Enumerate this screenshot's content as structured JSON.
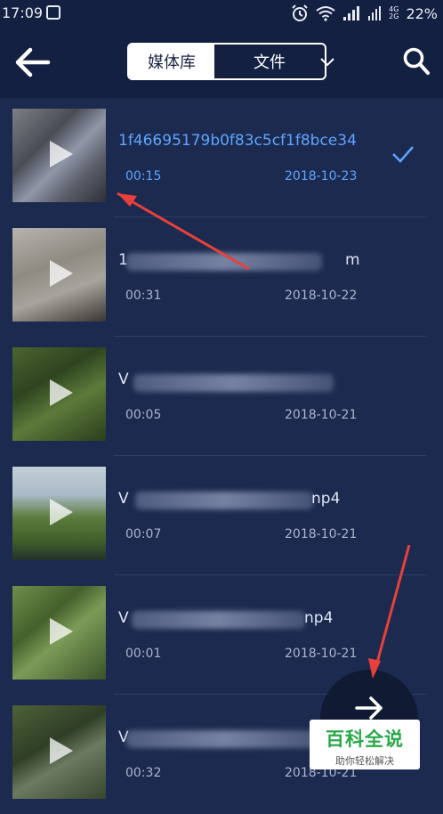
{
  "status_bar": {
    "time": "17:09",
    "battery": "22%",
    "network_top": "4G",
    "network_bottom": "2G"
  },
  "header": {
    "tabs": [
      {
        "label": "媒体库",
        "active": true
      },
      {
        "label": "文件",
        "active": false
      }
    ]
  },
  "videos": [
    {
      "name": "1f46695179b0f83c5cf1f8bce34",
      "duration": "00:15",
      "date": "2018-10-23",
      "selected": true
    },
    {
      "name": "1",
      "name_end": "m",
      "duration": "00:31",
      "date": "2018-10-22",
      "selected": false
    },
    {
      "name": "V",
      "duration": "00:05",
      "date": "2018-10-21",
      "selected": false
    },
    {
      "name": "V",
      "name_end": "np4",
      "duration": "00:07",
      "date": "2018-10-21",
      "selected": false
    },
    {
      "name": "V",
      "name_end": "np4",
      "duration": "00:01",
      "date": "2018-10-21",
      "selected": false
    },
    {
      "name": "V",
      "duration": "00:32",
      "date": "2018-10-21",
      "selected": false
    }
  ],
  "watermark": {
    "title": "百科全说",
    "subtitle": "助你轻松解决"
  },
  "colors": {
    "background": "#1c2a4f",
    "header": "#142042",
    "accent": "#5ea4ff",
    "annotation": "#e8403a"
  },
  "icons": [
    "back-arrow-icon",
    "chevron-down-icon",
    "search-icon",
    "play-icon",
    "checkmark-icon",
    "next-arrow-icon",
    "alarm-icon",
    "wifi-icon",
    "signal-icon"
  ]
}
